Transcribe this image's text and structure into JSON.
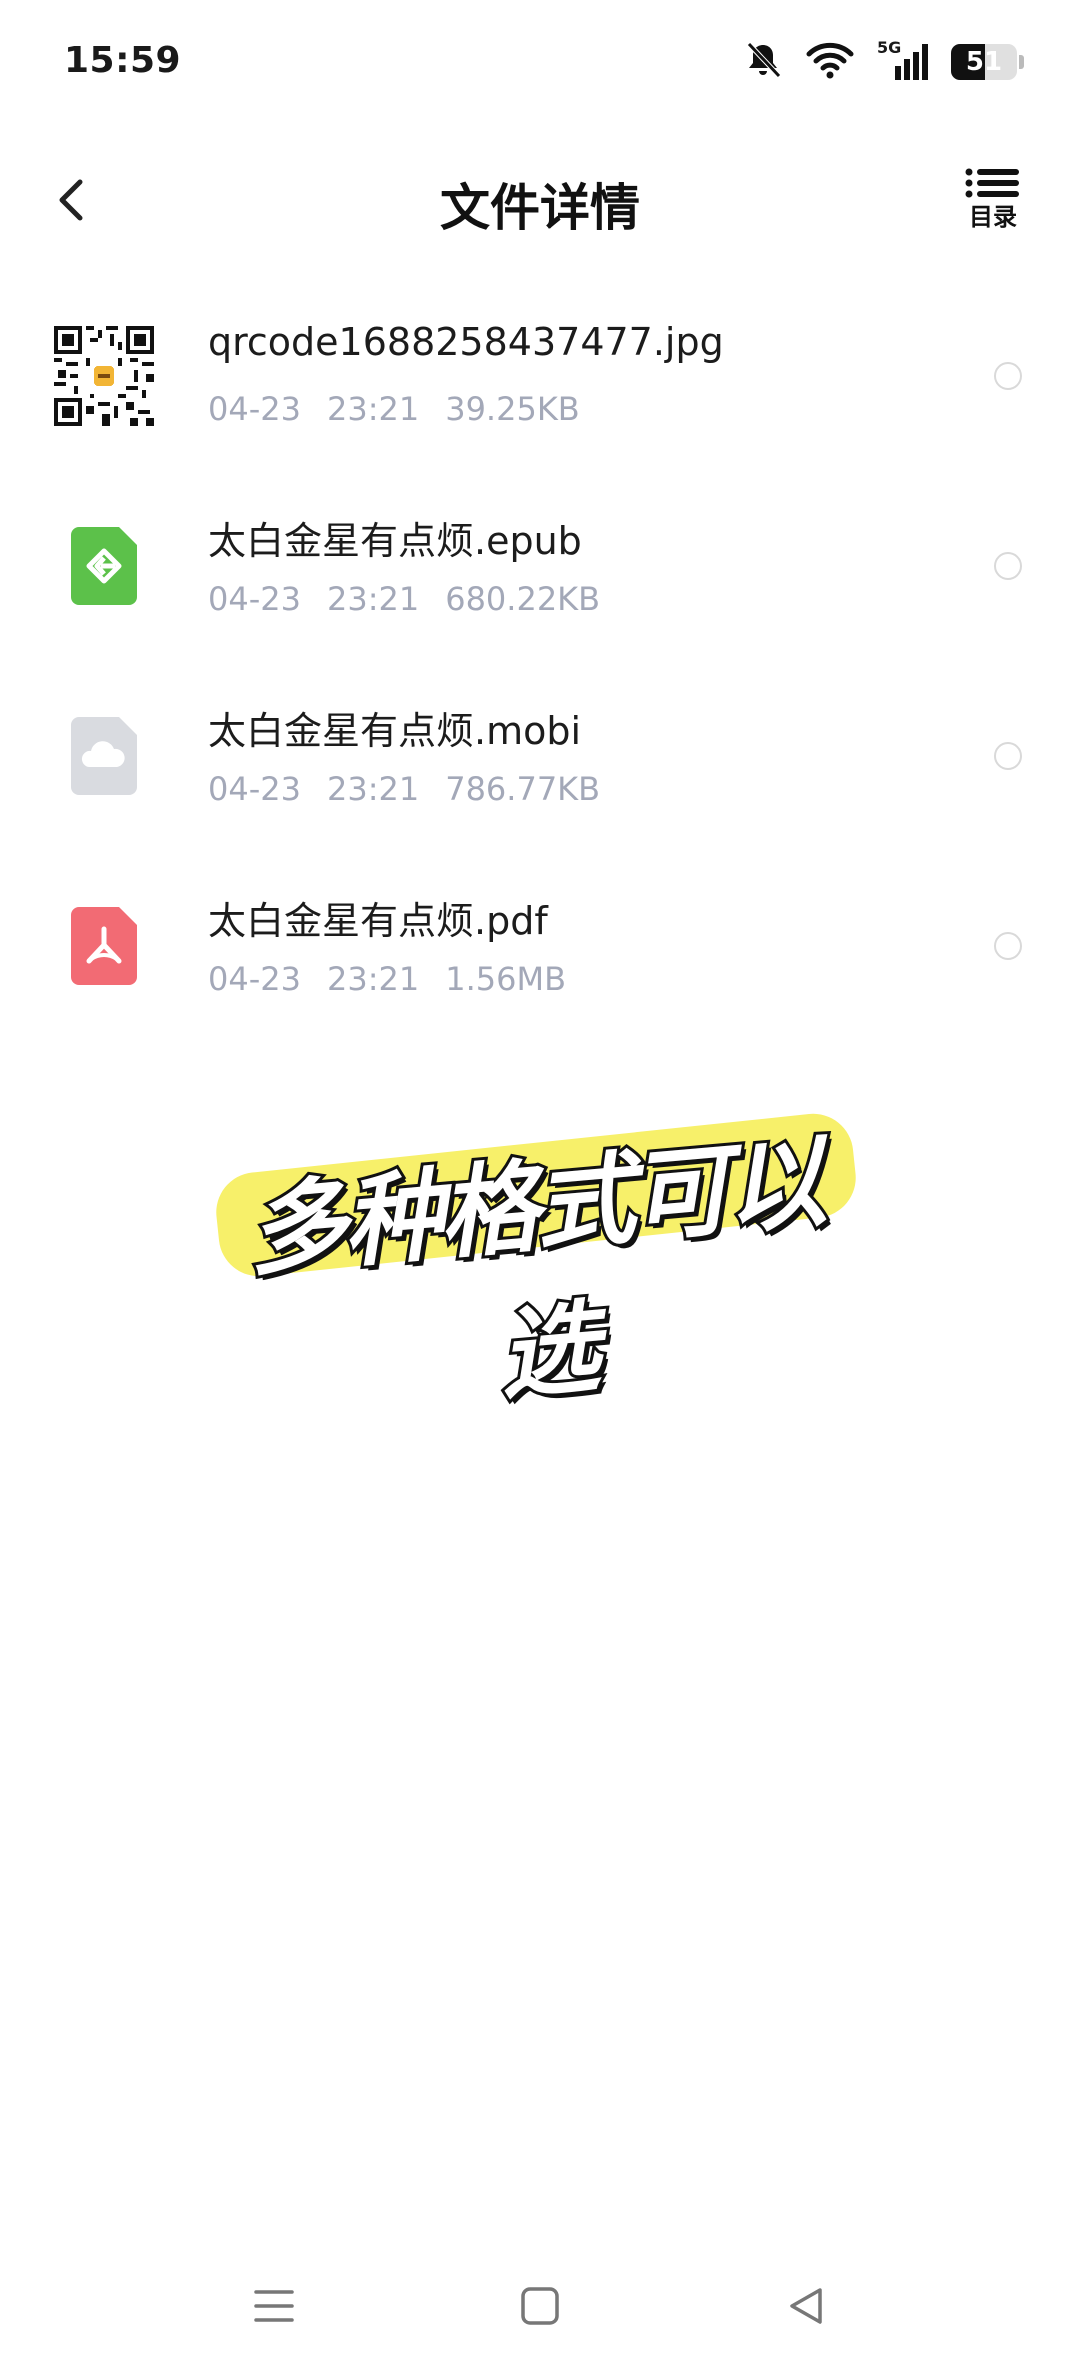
{
  "status_bar": {
    "time": "15:59",
    "network": "5G",
    "battery": "51",
    "battery_level": 0.51,
    "icons": [
      "bell-muted-icon",
      "wifi-icon",
      "signal-5g-icon",
      "battery-icon"
    ]
  },
  "header": {
    "back_icon": "chevron-left-icon",
    "title": "文件详情",
    "toc_label": "目录",
    "toc_icon": "list-icon"
  },
  "files": [
    {
      "name": "qrcode1688258437477.jpg",
      "date": "04-23",
      "time": "23:21",
      "size": "39.25KB",
      "icon": "qr-code-icon",
      "selected": false
    },
    {
      "name": "太白金星有点烦.epub",
      "date": "04-23",
      "time": "23:21",
      "size": "680.22KB",
      "icon": "epub-file-icon",
      "selected": false
    },
    {
      "name": "太白金星有点烦.mobi",
      "date": "04-23",
      "time": "23:21",
      "size": "786.77KB",
      "icon": "cloud-file-icon",
      "selected": false
    },
    {
      "name": "太白金星有点烦.pdf",
      "date": "04-23",
      "time": "23:21",
      "size": "1.56MB",
      "icon": "pdf-file-icon",
      "selected": false
    }
  ],
  "caption": {
    "text": "多种格式可以选",
    "highlight_color": "#f7f06a"
  },
  "nav_bar": {
    "icons": [
      "menu-nav-icon",
      "home-nav-icon",
      "back-nav-icon"
    ]
  },
  "colors": {
    "epub": "#5cc14a",
    "mobi": "#d9dbe0",
    "pdf": "#f26b74",
    "meta_text": "#a3a8b8"
  }
}
